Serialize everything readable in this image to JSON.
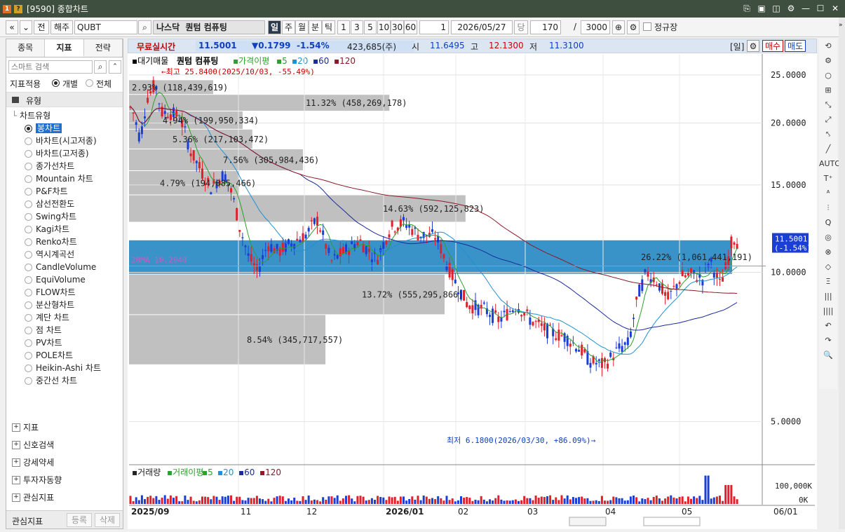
{
  "window": {
    "title": "[9590] 종합차트",
    "num_icon": "1",
    "help_icon": "?"
  },
  "toolbar": {
    "nav_prev": "«",
    "nav_down": "⌄",
    "prev": "전",
    "region": "해주",
    "symbol": "QUBT",
    "market": "나스닥",
    "name": "퀀텀 컴퓨팅",
    "periods": [
      "일",
      "주",
      "월",
      "분",
      "틱"
    ],
    "period_selected": "일",
    "intervals": [
      "1",
      "3",
      "5",
      "10",
      "30",
      "60"
    ],
    "interval_value": "1",
    "date": "2026/05/27",
    "dang": "당",
    "count": "170",
    "slash": "/",
    "total": "3000",
    "regular_label": "정규장"
  },
  "left": {
    "tabs": [
      "종목",
      "지표",
      "전략"
    ],
    "active_tab": "지표",
    "search_placeholder": "스마트 검색",
    "apply_label": "지표적용",
    "apply_opts": [
      "개별",
      "전체"
    ],
    "type_header": "유형",
    "chart_type_header": "차트유형",
    "chart_types": [
      "봉차트",
      "바차트(시고저종)",
      "바차트(고저종)",
      "종가선차트",
      "Mountain 차트",
      "P&F차트",
      "삼선전환도",
      "Swing차트",
      "Kagi차트",
      "Renko차트",
      "역시계곡선",
      "CandleVolume",
      "EquiVolume",
      "FLOW차트",
      "분산형차트",
      "계단 차트",
      "점 차트",
      "PV차트",
      "POLE차트",
      "Heikin-Ashi 차트",
      "중간선 차트"
    ],
    "selected_type": "봉차트",
    "sections": [
      "지표",
      "신호검색",
      "강세약세",
      "투자자동향",
      "관심지표"
    ],
    "fav_label": "관심지표",
    "fav_btn1": "등록",
    "fav_btn2": "삭제"
  },
  "info": {
    "realtime": "무료실시간",
    "price": "11.5001",
    "change": "▼0.1799",
    "pct": "-1.54%",
    "volume": "423,685(주)",
    "open_l": "시",
    "open": "11.6495",
    "high_l": "고",
    "high": "12.1300",
    "low_l": "저",
    "low": "11.3100",
    "period": "[일]",
    "buy": "매수",
    "sell": "매도"
  },
  "legend": {
    "title": "대기매물",
    "name": "퀀텀 컴퓨팅",
    "ma_label": "가격이평",
    "mas": [
      "5",
      "20",
      "60",
      "120"
    ],
    "ma_colors": [
      "#2e9e2e",
      "#2090d0",
      "#1a2a9a",
      "#8a1a2a"
    ]
  },
  "chart_data": {
    "type": "candlestick",
    "price_axis": {
      "ticks": [
        "25.0000",
        "20.0000",
        "15.0000",
        "10.0000",
        "5.0000"
      ],
      "values": [
        25,
        20,
        15,
        10,
        5
      ],
      "range": [
        4.2,
        27.2
      ]
    },
    "x_labels": [
      "2025/09",
      "11",
      "12",
      "2026/01",
      "02",
      "03",
      "04",
      "05"
    ],
    "y_last_label": "11.5001",
    "y_last_pct": "(-1.54%)",
    "max_annotation": "←최고 25.8400(2025/10/03, -55.49%)",
    "min_annotation": "최저 6.1800(2026/03/30, +86.09%)→",
    "ma20_label": "20MA 10.2940",
    "volume_profile": [
      {
        "label": "2.93%  (118,439,619)",
        "lo": 22.8,
        "hi": 24.4,
        "pct": 2.93,
        "highlight": false
      },
      {
        "label": "11.32% (458,269,178)",
        "lo": 21.1,
        "hi": 22.8,
        "pct": 11.32,
        "highlight": false
      },
      {
        "label": "4.94% (199,950,334)",
        "lo": 19.4,
        "hi": 21.1,
        "pct": 4.94,
        "highlight": false
      },
      {
        "label": "5.36% (217,103,472)",
        "lo": 17.7,
        "hi": 19.4,
        "pct": 5.36,
        "highlight": false
      },
      {
        "label": "7.56% (305,984,436)",
        "lo": 16.0,
        "hi": 17.7,
        "pct": 7.56,
        "highlight": false
      },
      {
        "label": "4.79% (194,085,466)",
        "lo": 14.3,
        "hi": 16.0,
        "pct": 4.79,
        "highlight": false
      },
      {
        "label": "14.63% (592,125,823)",
        "lo": 12.6,
        "hi": 14.3,
        "pct": 14.63,
        "highlight": false
      },
      {
        "label": "26.22% (1,061,441,191)",
        "lo": 9.9,
        "hi": 11.6,
        "pct": 26.22,
        "highlight": true
      },
      {
        "label": "13.72% (555,295,866)",
        "lo": 8.2,
        "hi": 9.9,
        "pct": 13.72,
        "highlight": false
      },
      {
        "label": "8.54% (345,717,557)",
        "lo": 6.5,
        "hi": 8.2,
        "pct": 8.54,
        "highlight": false
      }
    ],
    "volume_panel": {
      "title": "거래량",
      "ma_label": "거래이평",
      "mas": [
        "5",
        "20",
        "60",
        "120"
      ],
      "ticks": [
        "100,000K",
        "0K"
      ],
      "last_date": "06/01"
    }
  },
  "right_tools": [
    "⟲",
    "⚙",
    "○",
    "⊞",
    "⤡",
    "⤢",
    "⤣",
    "╱",
    "AUTO",
    "T⁺",
    "ᴬ",
    "⫶",
    "Q",
    "◎",
    "⊗",
    "◇",
    "Ξ",
    "|||",
    "||||",
    "↶",
    "↷",
    "🔍"
  ]
}
